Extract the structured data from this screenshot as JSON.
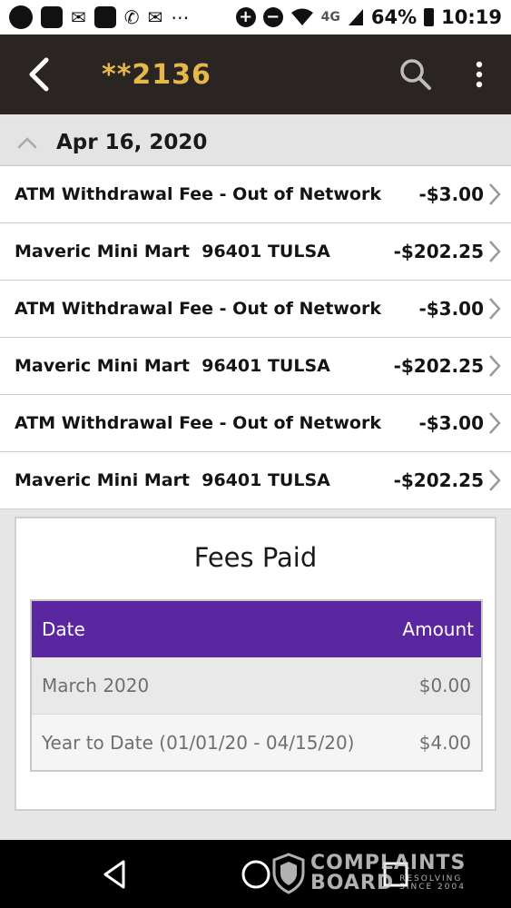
{
  "status_bar": {
    "network": "4G",
    "battery": "64%",
    "time": "10:19"
  },
  "app_bar": {
    "title": "**2136"
  },
  "section": {
    "date": "Apr 16, 2020"
  },
  "transactions": [
    {
      "description": "ATM Withdrawal Fee - Out of Network",
      "amount": "-$3.00"
    },
    {
      "description": "Maveric Mini Mart  96401 TULSA",
      "amount": "-$202.25"
    },
    {
      "description": "ATM Withdrawal Fee - Out of Network",
      "amount": "-$3.00"
    },
    {
      "description": "Maveric Mini Mart  96401 TULSA",
      "amount": "-$202.25"
    },
    {
      "description": "ATM Withdrawal Fee - Out of Network",
      "amount": "-$3.00"
    },
    {
      "description": "Maveric Mini Mart  96401 TULSA",
      "amount": "-$202.25"
    }
  ],
  "fees": {
    "title": "Fees Paid",
    "header_date": "Date",
    "header_amount": "Amount",
    "rows": [
      {
        "label": "March 2020",
        "amount": "$0.00"
      },
      {
        "label": "Year to Date (01/01/20 - 04/15/20)",
        "amount": "$4.00"
      }
    ]
  },
  "watermark": {
    "line1": "COMPLAINTS",
    "line2": "BOARD",
    "small1": "RESOLVING",
    "small2": "SINCE 2004"
  },
  "colors": {
    "app_bar": "#2a2522",
    "title_accent": "#e6b84a",
    "fees_header": "#5b27a0"
  }
}
